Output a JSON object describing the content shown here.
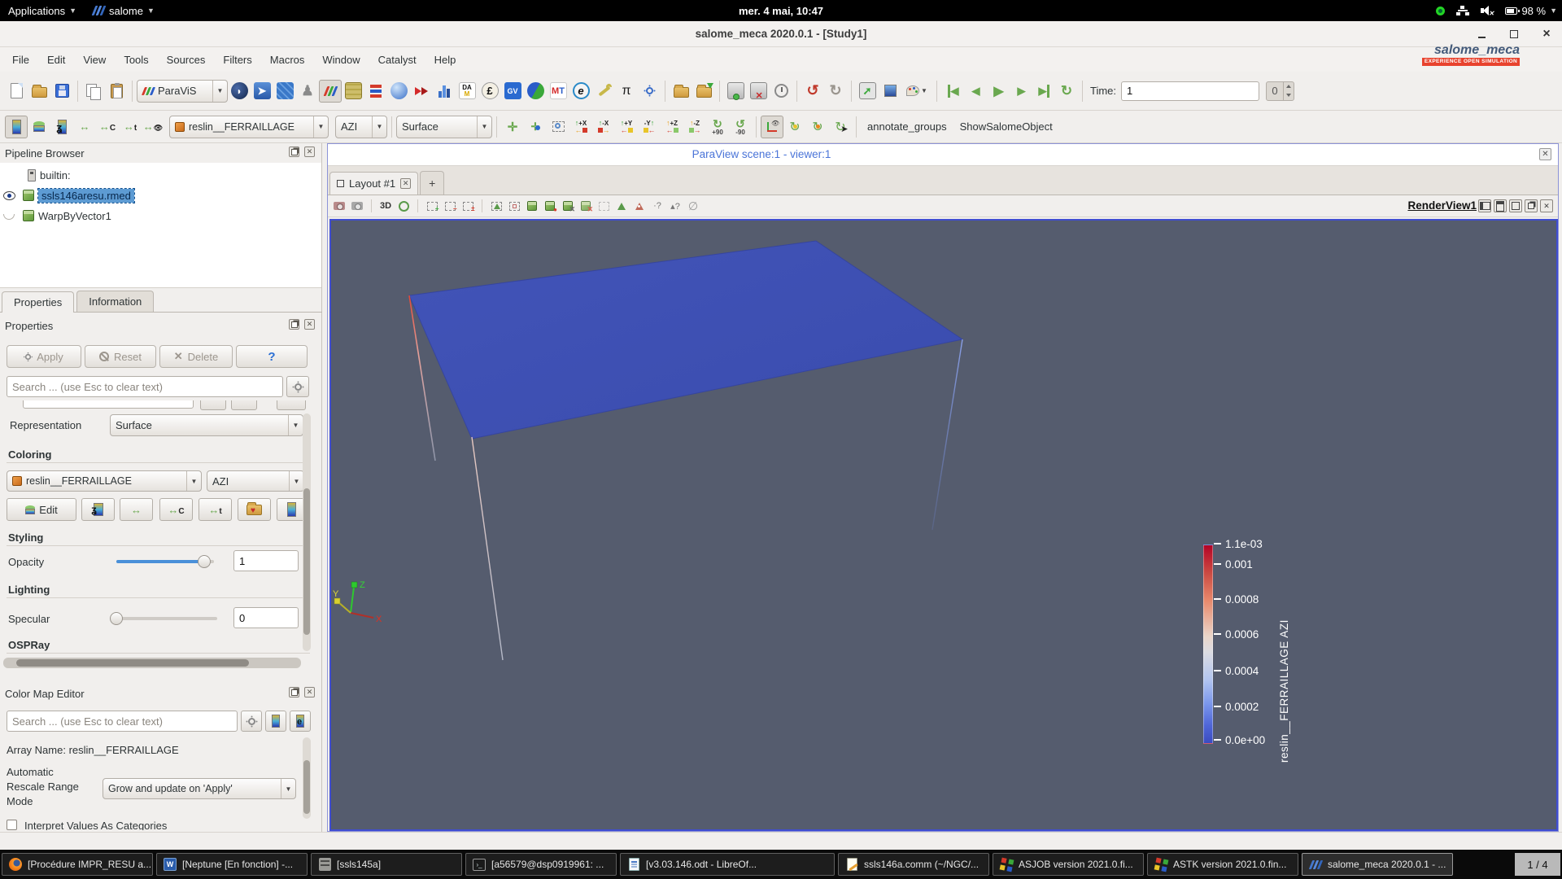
{
  "topbar": {
    "applications": "Applications",
    "app_name": "salome",
    "clock": "mer.  4 mai, 10:47",
    "battery": "98 %"
  },
  "window": {
    "title": "salome_meca 2020.0.1 - [Study1]"
  },
  "menubar": {
    "items": [
      "File",
      "Edit",
      "View",
      "Tools",
      "Sources",
      "Filters",
      "Macros",
      "Window",
      "Catalyst",
      "Help"
    ]
  },
  "logo": {
    "name": "salome_meca",
    "tagline": "EXPERIENCE OPEN SIMULATION"
  },
  "toolbar1": {
    "module_selector": "ParaViS",
    "time_label": "Time:",
    "time_value": "1",
    "frame_value": "0"
  },
  "toolbar2": {
    "array": "reslin__FERRAILLAGE",
    "component": "AZI",
    "representation": "Surface",
    "rot_plus": "+90",
    "rot_minus": "-90",
    "annotate_groups": "annotate_groups",
    "show_salome_object": "ShowSalomeObject"
  },
  "pipeline": {
    "title": "Pipeline Browser",
    "items": [
      {
        "label": "builtin:"
      },
      {
        "label": "ssls146aresu.rmed"
      },
      {
        "label": "WarpByVector1"
      }
    ]
  },
  "properties": {
    "tab_properties": "Properties",
    "tab_information": "Information",
    "panel_title": "Properties",
    "apply": "Apply",
    "reset": "Reset",
    "delete": "Delete",
    "help": "?",
    "search_placeholder": "Search ... (use Esc to clear text)",
    "representation_label": "Representation",
    "representation_value": "Surface",
    "coloring": "Coloring",
    "array": "reslin__FERRAILLAGE",
    "component": "AZI",
    "edit": "Edit",
    "styling": "Styling",
    "opacity_label": "Opacity",
    "opacity_value": "1",
    "lighting": "Lighting",
    "specular_label": "Specular",
    "specular_value": "0",
    "ospray": "OSPRay"
  },
  "color_map_editor": {
    "title": "Color Map Editor",
    "search_placeholder": "Search ... (use Esc to clear text)",
    "array_name": "Array Name: reslin__FERRAILLAGE",
    "rescale_label_1": "Automatic",
    "rescale_label_2": "Rescale Range",
    "rescale_label_3": "Mode",
    "rescale_value": "Grow and update on 'Apply'",
    "partial_checkbox": "Interpret Values As Categories"
  },
  "viewer": {
    "scene_title": "ParaView scene:1 - viewer:1",
    "layout_tab": "Layout #1",
    "new_tab": "+",
    "mode_3d": "3D",
    "render_view": "RenderView1"
  },
  "scene": {
    "triad": {
      "x": "X",
      "y": "Y",
      "z": "Z"
    },
    "legend": {
      "title": "reslin__FERRAILLAGE AZI",
      "ticks": [
        "1.1e-03",
        "0.001",
        "0.0008",
        "0.0006",
        "0.0004",
        "0.0002",
        "0.0e+00"
      ]
    }
  },
  "taskbar": {
    "items": [
      {
        "label": "[Procédure IMPR_RESU a..."
      },
      {
        "label": "[Neptune [En fonction] -..."
      },
      {
        "label": "[ssls145a]"
      },
      {
        "label": "[a56579@dsp0919961: ..."
      },
      {
        "label": "[v3.03.146.odt - LibreOf..."
      },
      {
        "label": "ssls146a.comm (~/NGC/..."
      },
      {
        "label": "ASJOB version 2021.0.fi..."
      },
      {
        "label": "ASTK version 2021.0.fin..."
      },
      {
        "label": "salome_meca 2020.0.1 - ..."
      }
    ],
    "pager": "1 / 4"
  }
}
